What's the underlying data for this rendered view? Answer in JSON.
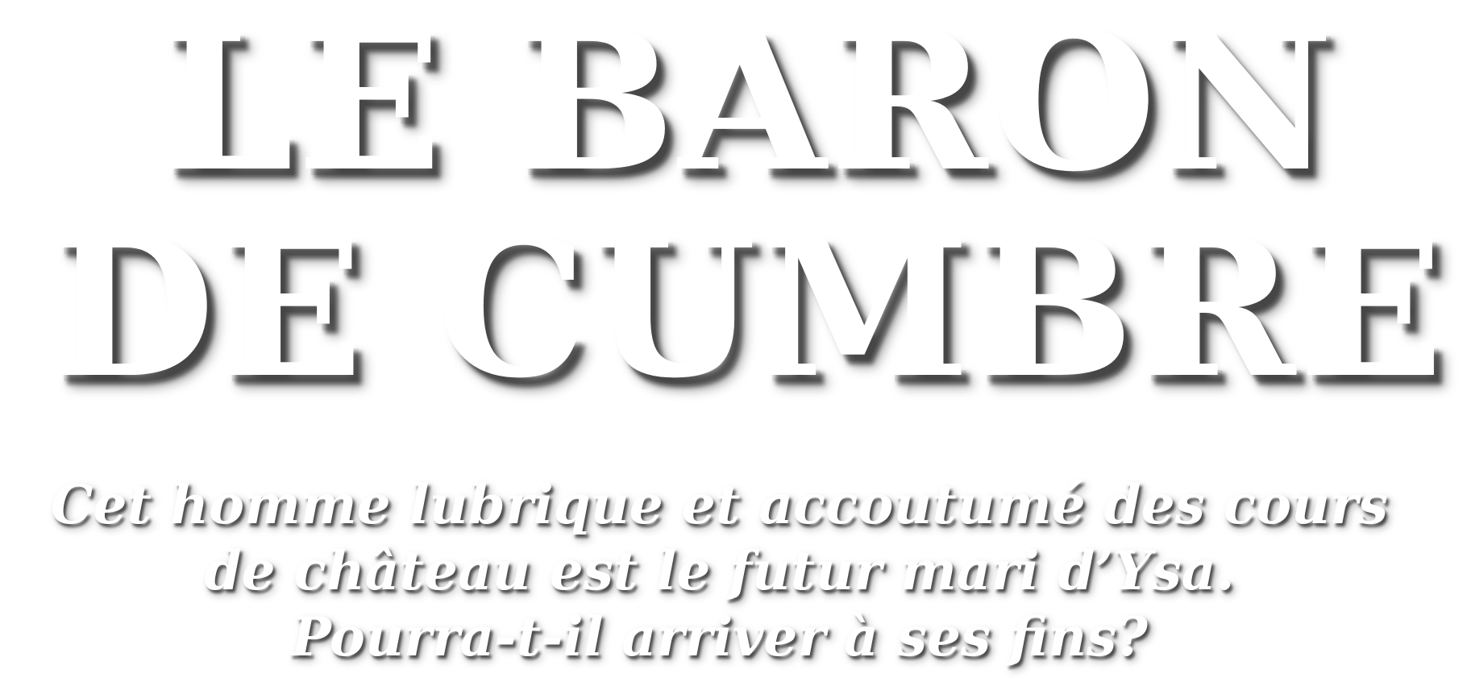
{
  "title": {
    "line1": "LE BARON",
    "line2": "DE CUMBRE"
  },
  "tagline": {
    "line1": "Cet homme lubrique et accoutumé des cours",
    "line2": "de château est le futur mari d’Ysa.",
    "line3": "Pourra-t-il arriver à ses fins?"
  },
  "colors": {
    "text": "#ffffff",
    "background": "#ffffff",
    "shadow": "#000000"
  }
}
